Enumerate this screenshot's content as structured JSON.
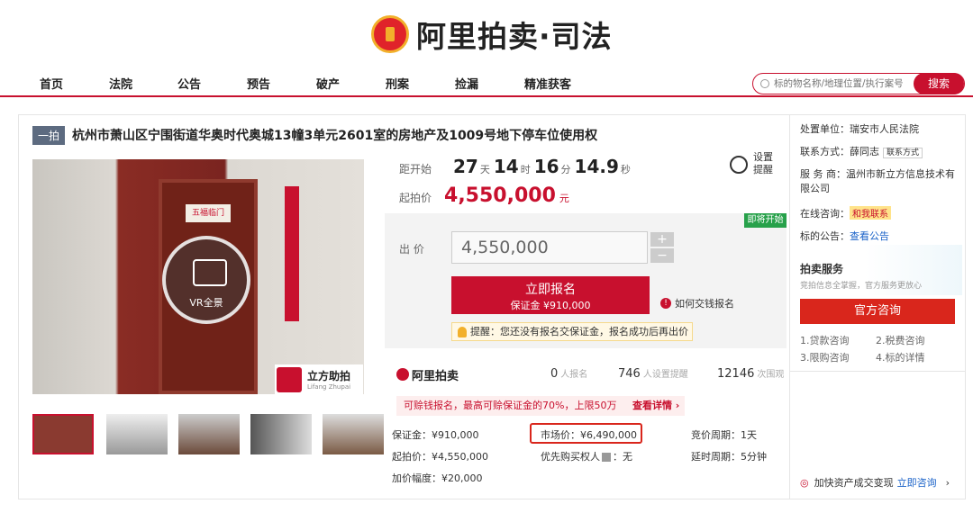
{
  "brand": {
    "logo_text": "阿里拍卖·司法"
  },
  "nav": [
    "首页",
    "法院",
    "公告",
    "预告",
    "破产",
    "刑案",
    "捡漏",
    "精准获客"
  ],
  "search": {
    "placeholder": "标的物名称/地理位置/执行案号",
    "button": "搜索"
  },
  "item": {
    "round_tag": "一拍",
    "title": "杭州市萧山区宁围街道华奥时代奥城13幢3单元2601室的房地产及1009号地下停车位使用权"
  },
  "image": {
    "vr_label": "VR全景",
    "watermark_cn": "立方助拍",
    "watermark_en": "Lifang Zhupai",
    "door_notice": "五福临门"
  },
  "countdown": {
    "label": "距开始",
    "days": "27",
    "d_unit": "天",
    "hours": "14",
    "h_unit": "时",
    "mins": "16",
    "m_unit": "分",
    "secs": "14.9",
    "s_unit": "秒"
  },
  "start_price": {
    "label": "起拍价",
    "value": "4,550,000",
    "unit": "元"
  },
  "remind": {
    "line1": "设置",
    "line2": "提醒"
  },
  "bid": {
    "badge": "即将开始",
    "label": "出 价",
    "value": "4,550,000",
    "plus": "+",
    "minus": "−",
    "apply_line1": "立即报名",
    "apply_line2": "保证金 ¥910,000",
    "howpay": "如何交钱报名",
    "tip": "提醒：您还没有报名交保证金，报名成功后再出价"
  },
  "stats": {
    "brand": "阿里拍卖",
    "signed": "0",
    "signed_label": "人报名",
    "reminders": "746",
    "reminders_label": "人设置提醒",
    "views": "12146",
    "views_label": "次围观"
  },
  "promo": {
    "text": "可赊钱报名，最高可赊保证金的70%，上限50万",
    "link": "查看详情 ›"
  },
  "details": {
    "deposit": "保证金：¥910,000",
    "market": "市场价：¥6,490,000",
    "cycle": "竞价周期：1天",
    "start": "起拍价：¥4,550,000",
    "priority": "优先购买权人",
    "priority_value": "：无",
    "delay": "延时周期：5分钟",
    "increment": "加价幅度：¥20,000"
  },
  "side": {
    "court_label": "处置单位：",
    "court": "瑞安市人民法院",
    "contact_label": "联系方式：",
    "contact": "薛同志",
    "contact_btn": "联系方式",
    "provider_label": "服 务 商：",
    "provider": "温州市新立方信息技术有限公司",
    "consult_label": "在线咨询：",
    "chat": "和我联系",
    "notice_label": "标的公告：",
    "notice_link": "查看公告",
    "svc_title": "拍卖服务",
    "svc_desc": "竞拍信息全掌握，官方服务更放心",
    "svc_btn": "官方咨询",
    "faq": [
      "1.贷款咨询",
      "2.税费咨询",
      "3.限购咨询",
      "4.标的详情"
    ],
    "fast": "加快资产成交变现",
    "fast_link": "立即咨询"
  },
  "colors": {
    "accent": "#c8102e",
    "green": "#27a14a",
    "gray_tag": "#5d6b80"
  }
}
